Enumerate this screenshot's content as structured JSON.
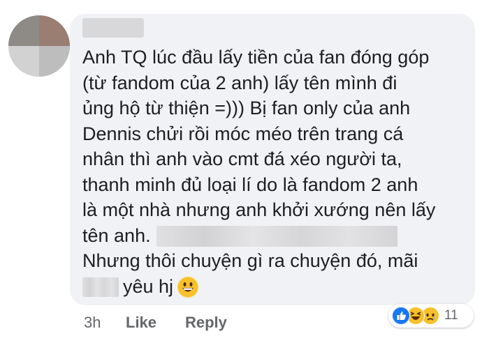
{
  "comment": {
    "lines": [
      "Anh TQ lúc đầu lấy tiền của fan đóng góp",
      "(từ fandom của 2 anh) lấy tên mình đi",
      "ủng hộ từ thiện =))) Bị fan only của anh",
      "Dennis chửi rồi móc méo trên trang cá",
      "nhân thì anh vào cmt đá xéo người ta,",
      "thanh minh đủ loại lí do là fandom 2 anh",
      "là một nhà nhưng anh khởi xướng nên lấy",
      "tên anh.",
      "Nhưng thôi chuyện gì ra chuyện đó, mãi",
      "yêu hj"
    ]
  },
  "actions": {
    "time": "3h",
    "like": "Like",
    "reply": "Reply"
  },
  "reactions": {
    "icons": [
      "like-reaction",
      "haha-reaction",
      "sad-reaction"
    ],
    "count": "11"
  },
  "colors": {
    "bubble": "#f0f2f5",
    "text": "#1c1e21",
    "meta": "#65676b",
    "like_blue": "#1877f2",
    "emoji_yellow": "#f7c02c"
  }
}
